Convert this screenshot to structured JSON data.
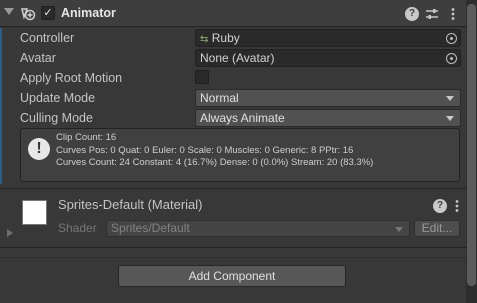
{
  "component": {
    "title": "Animator",
    "enabled_mark": "✓"
  },
  "properties": [
    {
      "label": "Controller",
      "value": "Ruby",
      "kind": "object"
    },
    {
      "label": "Avatar",
      "value": "None (Avatar)",
      "kind": "object"
    },
    {
      "label": "Apply Root Motion",
      "value": "",
      "kind": "checkbox"
    },
    {
      "label": "Update Mode",
      "value": "Normal",
      "kind": "dropdown"
    },
    {
      "label": "Culling Mode",
      "value": "Always Animate",
      "kind": "dropdown"
    }
  ],
  "info": {
    "lines": [
      "Clip Count: 16",
      "Curves Pos: 0 Quat: 0 Euler: 0 Scale: 0 Muscles: 0 Generic: 8 PPtr: 16",
      "Curves Count: 24 Constant: 4 (16.7%) Dense: 0 (0.0%) Stream: 20 (83.3%)"
    ]
  },
  "material": {
    "title": "Sprites-Default (Material)",
    "shader_label": "Shader",
    "shader_value": "Sprites/Default",
    "edit_label": "Edit..."
  },
  "add_component_label": "Add Component",
  "colors": {
    "background": "#383838",
    "accent": "#2c5d87",
    "button": "#585858"
  }
}
